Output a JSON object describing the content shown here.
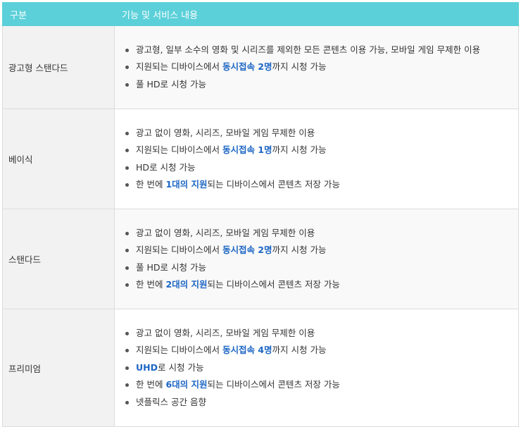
{
  "header": {
    "col1": "구분",
    "col2": "기능 및 서비스 내용"
  },
  "plans": [
    {
      "name": "광고형 스탠다드",
      "features": [
        {
          "parts": [
            {
              "text": "광고형, 일부 소수의 영화 및 시리즈를 제외한 모든 콘텐츠 이용 가능, 모바일 게임 무제한 이용"
            }
          ]
        },
        {
          "parts": [
            {
              "text": "지원되는 디바이스에서 "
            },
            {
              "text": "동시접속 2명",
              "highlight": true
            },
            {
              "text": "까지 시청 가능"
            }
          ]
        },
        {
          "parts": [
            {
              "text": "풀 HD로 시청 가능"
            }
          ]
        }
      ]
    },
    {
      "name": "베이식",
      "features": [
        {
          "parts": [
            {
              "text": "광고 없이 영화, 시리즈, 모바일 게임 무제한 이용"
            }
          ]
        },
        {
          "parts": [
            {
              "text": "지원되는 디바이스에서 "
            },
            {
              "text": "동시접속 1명",
              "highlight": true
            },
            {
              "text": "까지 시청 가능"
            }
          ]
        },
        {
          "parts": [
            {
              "text": "HD로 시청 가능"
            }
          ]
        },
        {
          "parts": [
            {
              "text": "한 번에 "
            },
            {
              "text": "1대의 지원",
              "highlight": true
            },
            {
              "text": "되는 디바이스에서 콘텐츠 저장 가능"
            }
          ]
        }
      ]
    },
    {
      "name": "스탠다드",
      "features": [
        {
          "parts": [
            {
              "text": "광고 없이 영화, 시리즈, 모바일 게임 무제한 이용"
            }
          ]
        },
        {
          "parts": [
            {
              "text": "지원되는 디바이스에서 "
            },
            {
              "text": "동시접속 2명",
              "highlight": true
            },
            {
              "text": "까지 시청 가능"
            }
          ]
        },
        {
          "parts": [
            {
              "text": "풀 HD로 시청 가능"
            }
          ]
        },
        {
          "parts": [
            {
              "text": "한 번에 "
            },
            {
              "text": "2대의 지원",
              "highlight": true
            },
            {
              "text": "되는 디바이스에서 콘텐츠 저장 가능"
            }
          ]
        }
      ]
    },
    {
      "name": "프리미엄",
      "features": [
        {
          "parts": [
            {
              "text": "광고 없이 영화, 시리즈, 모바일 게임 무제한 이용"
            }
          ]
        },
        {
          "parts": [
            {
              "text": "지원되는 디바이스에서 "
            },
            {
              "text": "동시접속 4명",
              "highlight": true
            },
            {
              "text": "까지 시청 가능"
            }
          ]
        },
        {
          "parts": [
            {
              "text": "UHD",
              "highlight": true
            },
            {
              "text": "로 시청 가능"
            }
          ]
        },
        {
          "parts": [
            {
              "text": "한 번에 "
            },
            {
              "text": "6대의 지원",
              "highlight": true
            },
            {
              "text": "되는 디바이스에서 콘텐츠 저장 가능"
            }
          ]
        },
        {
          "parts": [
            {
              "text": "넷플릭스 공간 음향"
            }
          ]
        }
      ]
    }
  ],
  "colors": {
    "header_bg": "#5bd0d9",
    "highlight": "#1d66c4",
    "category_bg": "#f2f2f2"
  }
}
